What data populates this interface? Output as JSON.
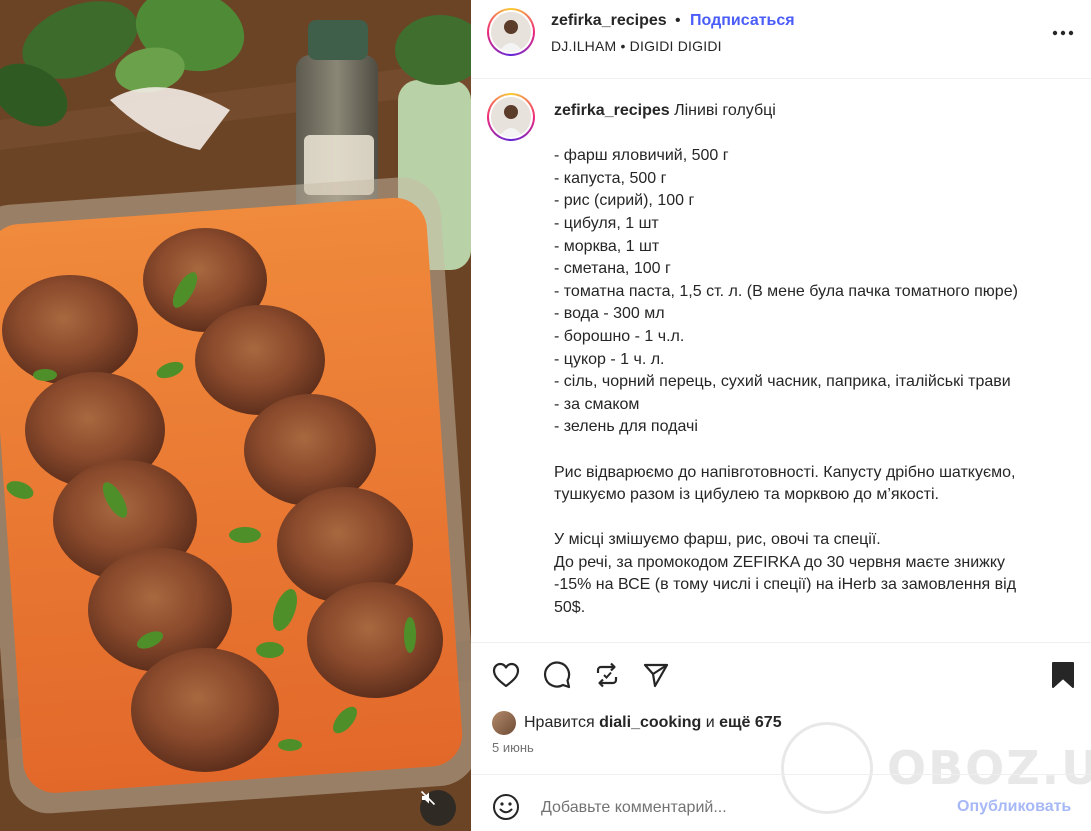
{
  "post": {
    "username": "zefirka_recipes",
    "separator": "•",
    "follow_label": "Подписаться",
    "audio": "DJ.ILHAM • DIGIDI DIGIDI",
    "more_icon": "more-horizontal-icon"
  },
  "caption": {
    "username": "zefirka_recipes",
    "title": "Ліниві голубці",
    "lines": [
      "",
      "- фарш яловичий, 500 г",
      "- капуста, 500 г",
      "- рис (сирий), 100 г",
      "- цибуля, 1 шт",
      "- морква, 1 шт",
      "- сметана, 100 г",
      "- томатна паста, 1,5 ст. л. (В мене була пачка томатного пюре)",
      "- вода - 300 мл",
      "- борошно - 1 ч.л.",
      "- цукор - 1 ч. л.",
      "- сіль, чорний перець, сухий часник, паприка, італійські трави",
      "- за смаком",
      "- зелень для подачі",
      "",
      "Рис відварюємо до напівготовності. Капусту дрібно шаткуємо,",
      "тушкуємо разом із цибулею та морквою до м’якості.",
      "",
      "У місці змішуємо фарш, рис, овочі та спеції.",
      "До речі, за промокодом ZEFIRKA до 30 червня маєте знижку",
      "-15% на ВСЕ (в тому числі і спеції) на iHerb за замовлення від",
      "50$."
    ]
  },
  "likes": {
    "prefix": "Нравится",
    "user": "diali_cooking",
    "middle": "и",
    "count_text": "ещё 675"
  },
  "date": "5 июнь",
  "comment": {
    "placeholder": "Добавьте комментарий...",
    "publish_label": "Опубликовать"
  },
  "watermark": "OBOZ.UA",
  "colors": {
    "link_blue": "#4a5df9",
    "publish_disabled": "#a7b8f7",
    "muted_text": "#737373",
    "divider": "#efefef"
  }
}
